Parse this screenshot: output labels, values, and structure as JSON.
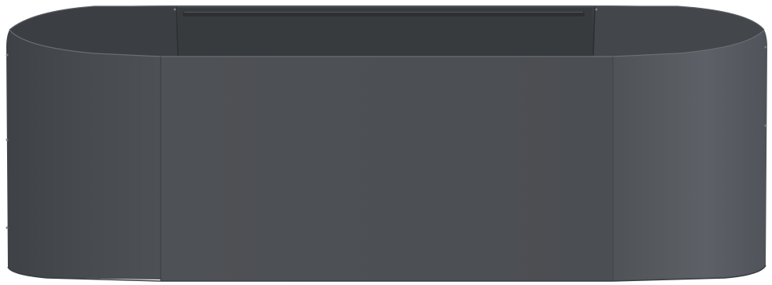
{
  "image": {
    "subject": "raised-garden-bed",
    "shape": "oval",
    "material": "powder-coated-steel",
    "colors": {
      "body_front": "#4b4e52",
      "body_front_light": "#55595e",
      "body_side_left": "#45484c",
      "body_side_right": "#5c6066",
      "interior": "#36393c",
      "interior_back": "#3d4044",
      "rim_highlight": "#6a6e73",
      "brace": "#2e3033",
      "background": "#ffffff"
    }
  }
}
